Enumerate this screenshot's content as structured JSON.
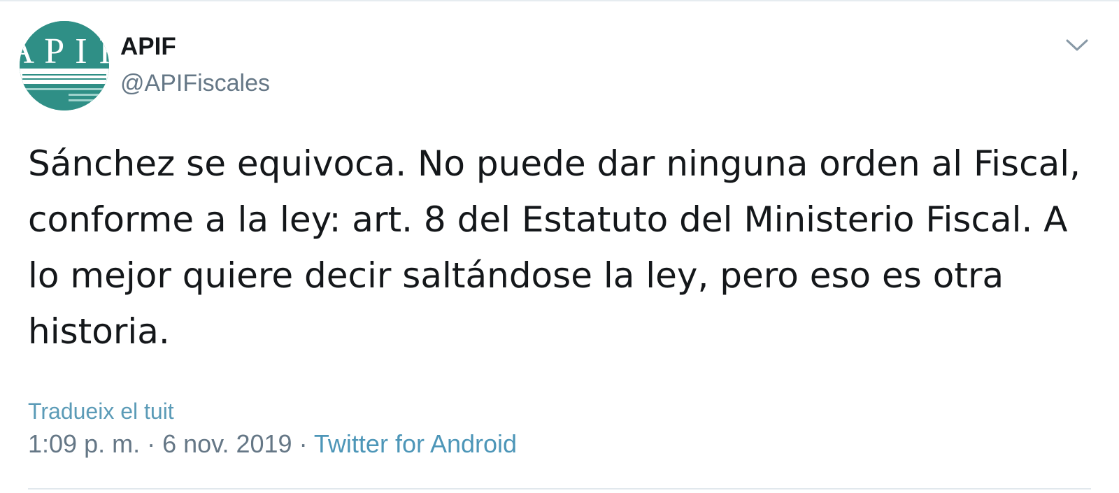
{
  "author": {
    "display_name": "APIF",
    "handle": "@APIFiscales",
    "avatar_logo_text": "APIF",
    "avatar_colors": {
      "background": "#2f8f86",
      "letters": "#ffffff",
      "band": "#ffffff"
    }
  },
  "menu": {
    "icon": "chevron-down-icon"
  },
  "tweet": {
    "text": "Sánchez se equivoca. No puede dar ninguna orden al Fiscal, conforme a la ley: art. 8 del Estatuto del Ministerio Fiscal. A lo mejor quiere decir saltándose la ley, pero eso es otra historia."
  },
  "translate": {
    "label": "Tradueix el tuit"
  },
  "meta": {
    "time": "1:09 p. m.",
    "separator": " · ",
    "date": "6 nov. 2019",
    "source": "Twitter for Android"
  },
  "colors": {
    "text": "#14171a",
    "secondary": "#657786",
    "link": "#4d96b8",
    "divider": "#e1e8ed"
  }
}
